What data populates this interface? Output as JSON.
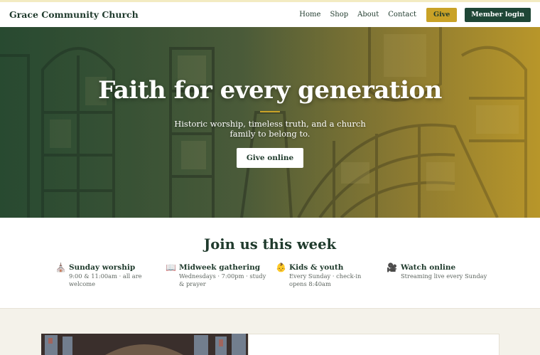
{
  "brand": {
    "name": "Grace Community Church"
  },
  "nav": {
    "links": [
      "Home",
      "Shop",
      "About",
      "Contact"
    ],
    "give_label": "Give",
    "member_label": "Member login"
  },
  "hero": {
    "title": "Faith for every generation",
    "subtitle": "Historic worship, timeless truth, and a church family to belong to.",
    "button_label": "Give online"
  },
  "week": {
    "title": "Join us this week",
    "items": [
      {
        "icon": "church-icon",
        "glyph": "⛪",
        "title": "Sunday worship",
        "desc": "9:00 & 11:00am · all are welcome"
      },
      {
        "icon": "book-icon",
        "glyph": "📖",
        "title": "Midweek gathering",
        "desc": "Wednesdays · 7:00pm · study & prayer"
      },
      {
        "icon": "child-icon",
        "glyph": "👶",
        "title": "Kids & youth",
        "desc": "Every Sunday · check-in opens 8:40am"
      },
      {
        "icon": "video-camera-icon",
        "glyph": "🎥",
        "title": "Watch online",
        "desc": "Streaming live every Sunday"
      }
    ]
  },
  "colors": {
    "accent_gold": "#c9a227",
    "brand_green": "#1e4636",
    "heading_green": "#1f3a2c"
  }
}
